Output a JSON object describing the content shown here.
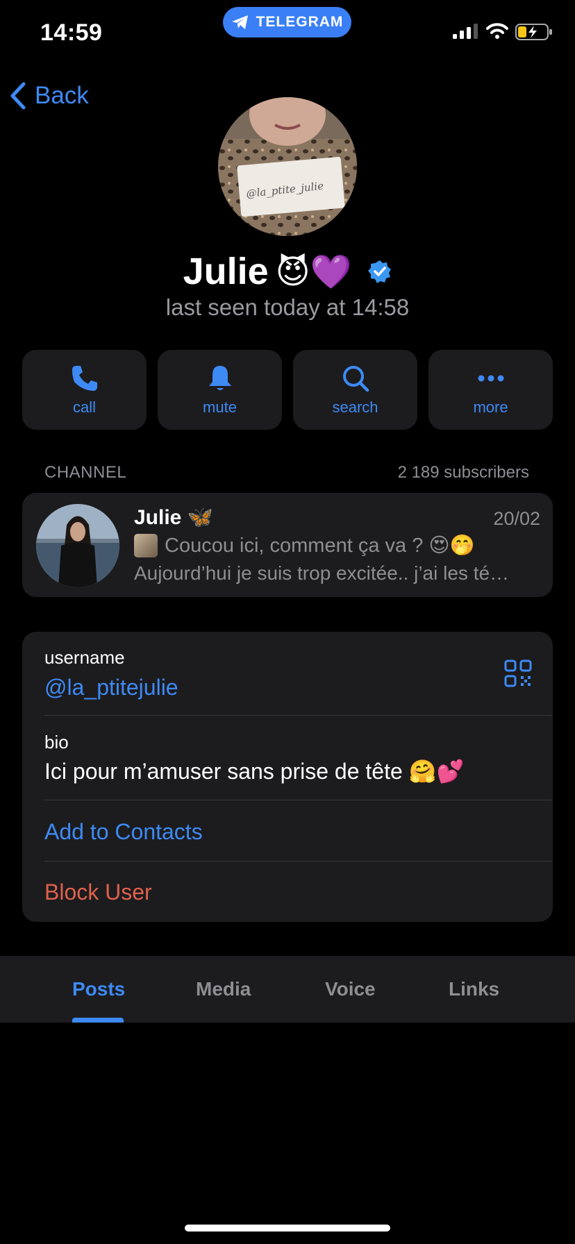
{
  "status_bar": {
    "time": "14:59",
    "app_pill": "TELEGRAM",
    "icons": [
      "telegram-plane-icon",
      "cellular-signal-icon",
      "wifi-icon",
      "battery-charging-icon"
    ]
  },
  "nav": {
    "back_label": "Back"
  },
  "profile": {
    "name": "Julie",
    "name_emojis": "😈💜",
    "verified": true,
    "last_seen": "last seen today at 14:58"
  },
  "actions": [
    {
      "label": "call",
      "icon": "phone-icon"
    },
    {
      "label": "mute",
      "icon": "bell-icon"
    },
    {
      "label": "search",
      "icon": "search-icon"
    },
    {
      "label": "more",
      "icon": "more-dots-icon"
    }
  ],
  "channel": {
    "header": "CHANNEL",
    "subscribers": "2 189 subscribers",
    "name": "Julie 🦋",
    "date": "20/02",
    "preview_line1": "Coucou ici, comment ça va ? 😍🤭",
    "preview_line2": "Aujourd’hui je suis trop excitée.. j’ai les té…"
  },
  "info": {
    "username_label": "username",
    "username_value": "@la_ptitejulie",
    "bio_label": "bio",
    "bio_value": "Ici pour m’amuser sans prise de tête 🤗💕",
    "add_contacts": "Add to Contacts",
    "block_user": "Block User"
  },
  "tabs": [
    {
      "label": "Posts",
      "active": true
    },
    {
      "label": "Media",
      "active": false
    },
    {
      "label": "Voice",
      "active": false
    },
    {
      "label": "Links",
      "active": false
    }
  ],
  "colors": {
    "accent": "#3e8af5",
    "danger": "#e0614d",
    "card": "#1c1c1e",
    "secondary_text": "#8e8e93"
  }
}
